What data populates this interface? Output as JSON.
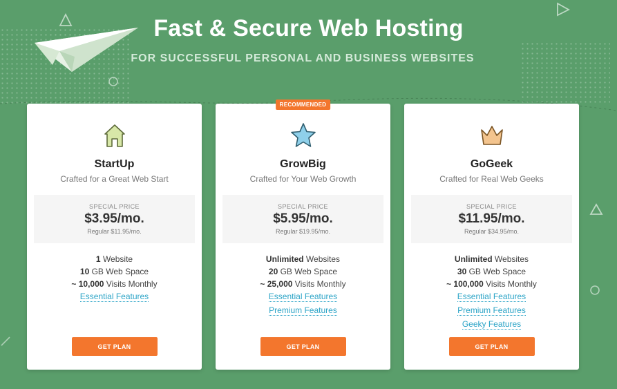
{
  "hero": {
    "title": "Fast & Secure Web Hosting",
    "subtitle": "FOR SUCCESSFUL PERSONAL AND BUSINESS WEBSITES"
  },
  "colors": {
    "background": "#5a9e6b",
    "accent": "#f3762d",
    "link": "#2ca4c7"
  },
  "plans": [
    {
      "icon": "house-icon",
      "name": "StartUp",
      "tagline": "Crafted for a Great Web Start",
      "special_label": "SPECIAL PRICE",
      "price": "$3.95/mo.",
      "regular": "Regular $11.95/mo.",
      "features": [
        {
          "bold": "1",
          "text": " Website"
        },
        {
          "bold": "10",
          "text": " GB Web Space"
        },
        {
          "bold": "~ 10,000",
          "text": " Visits Monthly"
        }
      ],
      "links": [
        "Essential Features"
      ],
      "button": "GET PLAN"
    },
    {
      "badge": "RECOMMENDED",
      "icon": "star-icon",
      "name": "GrowBig",
      "tagline": "Crafted for Your Web Growth",
      "special_label": "SPECIAL PRICE",
      "price": "$5.95/mo.",
      "regular": "Regular $19.95/mo.",
      "features": [
        {
          "bold": "Unlimited",
          "text": " Websites"
        },
        {
          "bold": "20",
          "text": " GB Web Space"
        },
        {
          "bold": "~ 25,000",
          "text": " Visits Monthly"
        }
      ],
      "links": [
        "Essential Features",
        "Premium Features"
      ],
      "button": "GET PLAN"
    },
    {
      "icon": "crown-icon",
      "name": "GoGeek",
      "tagline": "Crafted for Real Web Geeks",
      "special_label": "SPECIAL PRICE",
      "price": "$11.95/mo.",
      "regular": "Regular $34.95/mo.",
      "features": [
        {
          "bold": "Unlimited",
          "text": " Websites"
        },
        {
          "bold": "30",
          "text": " GB Web Space"
        },
        {
          "bold": "~ 100,000",
          "text": " Visits Monthly"
        }
      ],
      "links": [
        "Essential Features",
        "Premium Features",
        "Geeky Features"
      ],
      "button": "GET PLAN"
    }
  ]
}
